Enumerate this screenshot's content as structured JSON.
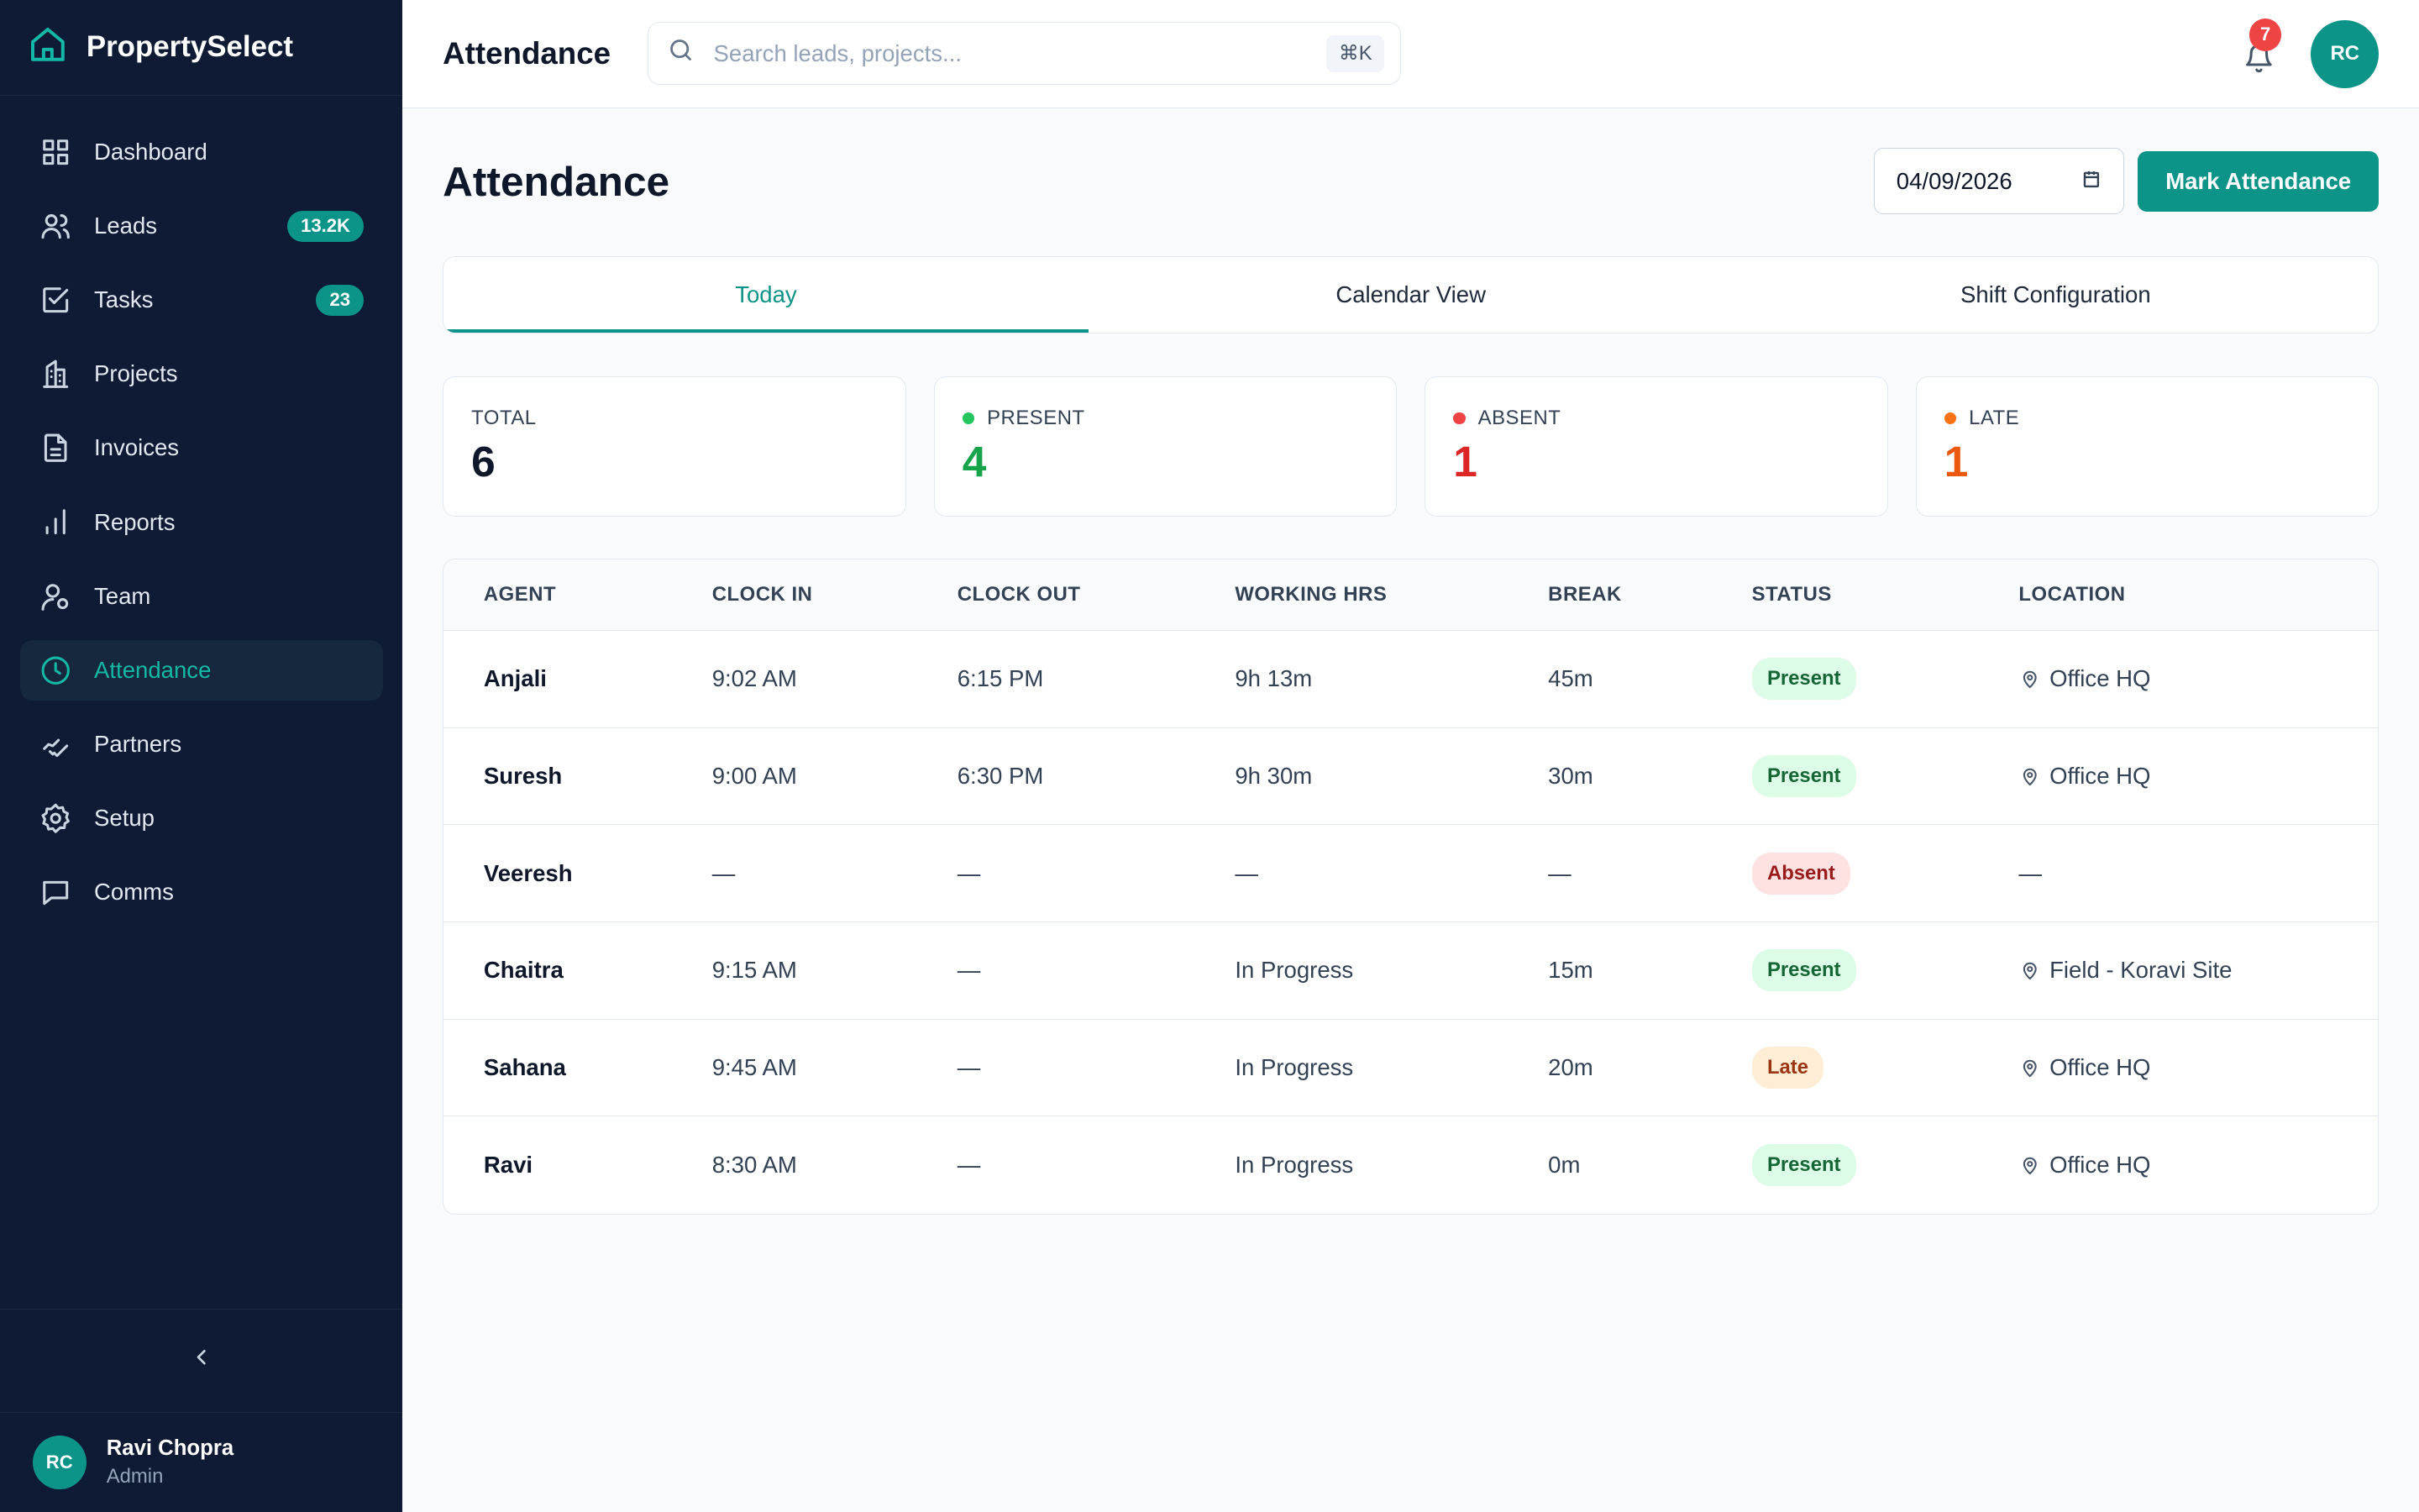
{
  "brand": {
    "name": "PropertySelect"
  },
  "sidebar": {
    "items": [
      {
        "label": "Dashboard",
        "icon": "grid-icon",
        "badge": ""
      },
      {
        "label": "Leads",
        "icon": "users-icon",
        "badge": "13.2K"
      },
      {
        "label": "Tasks",
        "icon": "checkbox-icon",
        "badge": "23"
      },
      {
        "label": "Projects",
        "icon": "building-icon",
        "badge": ""
      },
      {
        "label": "Invoices",
        "icon": "document-icon",
        "badge": ""
      },
      {
        "label": "Reports",
        "icon": "bar-chart-icon",
        "badge": ""
      },
      {
        "label": "Team",
        "icon": "user-icon",
        "badge": ""
      },
      {
        "label": "Attendance",
        "icon": "clock-icon",
        "badge": "",
        "active": true
      },
      {
        "label": "Partners",
        "icon": "handshake-icon",
        "badge": ""
      },
      {
        "label": "Setup",
        "icon": "gear-icon",
        "badge": ""
      },
      {
        "label": "Comms",
        "icon": "message-icon",
        "badge": ""
      }
    ],
    "user": {
      "initials": "RC",
      "name": "Ravi Chopra",
      "role": "Admin"
    }
  },
  "topbar": {
    "title": "Attendance",
    "search_placeholder": "Search leads, projects...",
    "shortcut": "⌘K",
    "notification_count": "7",
    "avatar_initials": "RC"
  },
  "page": {
    "title": "Attendance",
    "date": "04/09/2026",
    "mark_button": "Mark Attendance"
  },
  "tabs": [
    {
      "label": "Today",
      "active": true
    },
    {
      "label": "Calendar View",
      "active": false
    },
    {
      "label": "Shift Configuration",
      "active": false
    }
  ],
  "stats": [
    {
      "label": "TOTAL",
      "value": "6",
      "color": "#0f172a",
      "dot": ""
    },
    {
      "label": "PRESENT",
      "value": "4",
      "color": "#16a34a",
      "dot": "#22c55e"
    },
    {
      "label": "ABSENT",
      "value": "1",
      "color": "#dc2626",
      "dot": "#ef4444"
    },
    {
      "label": "LATE",
      "value": "1",
      "color": "#ea580c",
      "dot": "#f97316"
    }
  ],
  "table": {
    "headers": [
      "AGENT",
      "CLOCK IN",
      "CLOCK OUT",
      "WORKING HRS",
      "BREAK",
      "STATUS",
      "LOCATION"
    ],
    "rows": [
      {
        "agent": "Anjali",
        "clock_in": "9:02 AM",
        "clock_out": "6:15 PM",
        "hours": "9h 13m",
        "break": "45m",
        "status": "Present",
        "status_type": "present",
        "location": "Office HQ",
        "has_pin": true
      },
      {
        "agent": "Suresh",
        "clock_in": "9:00 AM",
        "clock_out": "6:30 PM",
        "hours": "9h 30m",
        "break": "30m",
        "status": "Present",
        "status_type": "present",
        "location": "Office HQ",
        "has_pin": true
      },
      {
        "agent": "Veeresh",
        "clock_in": "—",
        "clock_out": "—",
        "hours": "—",
        "break": "—",
        "status": "Absent",
        "status_type": "absent",
        "location": "—",
        "has_pin": false
      },
      {
        "agent": "Chaitra",
        "clock_in": "9:15 AM",
        "clock_out": "—",
        "hours": "In Progress",
        "break": "15m",
        "status": "Present",
        "status_type": "present",
        "location": "Field - Koravi Site",
        "has_pin": true
      },
      {
        "agent": "Sahana",
        "clock_in": "9:45 AM",
        "clock_out": "—",
        "hours": "In Progress",
        "break": "20m",
        "status": "Late",
        "status_type": "late",
        "location": "Office HQ",
        "has_pin": true
      },
      {
        "agent": "Ravi",
        "clock_in": "8:30 AM",
        "clock_out": "—",
        "hours": "In Progress",
        "break": "0m",
        "status": "Present",
        "status_type": "present",
        "location": "Office HQ",
        "has_pin": true
      }
    ]
  }
}
